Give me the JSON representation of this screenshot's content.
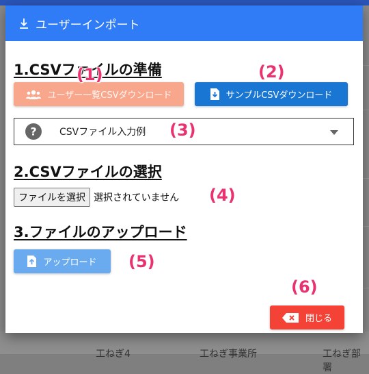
{
  "dialog": {
    "title": "ユーザーインポート",
    "section1_title": "1.CSVファイルの準備",
    "user_list_button": "ユーザー一覧CSVダウンロード",
    "sample_button": "サンプルCSVダウンロード",
    "example_label": "CSVファイル入力例",
    "section2_title": "2.CSVファイルの選択",
    "file_button": "ファイルを選択",
    "file_status": "選択されていません",
    "section3_title": "3.ファイルのアップロード",
    "upload_button": "アップロード",
    "close_button": "閉じる"
  },
  "annotations": [
    "(1)",
    "(2)",
    "(3)",
    "(4)",
    "(5)",
    "(6)"
  ],
  "background": {
    "bottom_cells": [
      "工ねぎ4",
      "工ねぎ事業所",
      "工ねぎ部署"
    ]
  },
  "colors": {
    "header": "#2f7cf6",
    "user_button": "#f8a78d",
    "sample_button": "#1976d2",
    "upload_button": "#6aabf0",
    "close_button": "#f44336",
    "annotation": "#e8336f"
  }
}
